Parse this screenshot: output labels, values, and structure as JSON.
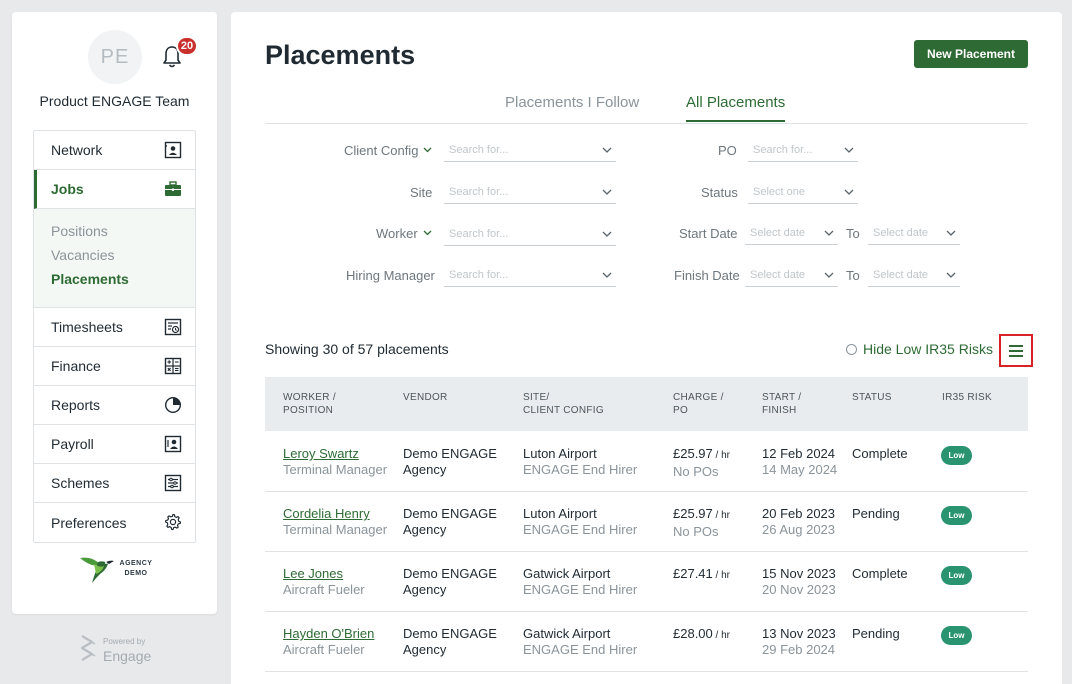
{
  "sidebar": {
    "avatar_initials": "PE",
    "notification_count": "20",
    "team_name": "Product ENGAGE Team",
    "nav": [
      {
        "label": "Network",
        "icon": "contact-card-icon"
      },
      {
        "label": "Jobs",
        "icon": "briefcase-icon"
      },
      {
        "label": "Timesheets",
        "icon": "timesheet-icon"
      },
      {
        "label": "Finance",
        "icon": "calculator-icon"
      },
      {
        "label": "Reports",
        "icon": "pie-chart-icon"
      },
      {
        "label": "Payroll",
        "icon": "payroll-icon"
      },
      {
        "label": "Schemes",
        "icon": "sliders-icon"
      },
      {
        "label": "Preferences",
        "icon": "gear-icon"
      }
    ],
    "jobs_sub": [
      "Positions",
      "Vacancies",
      "Placements"
    ],
    "agency_logo_text": "AGENCY DEMO",
    "powered_by": "Powered by",
    "powered_brand": "Engage"
  },
  "main": {
    "title": "Placements",
    "new_button": "New Placement",
    "tabs": [
      "Placements I Follow",
      "All Placements"
    ],
    "filters": {
      "client_config": {
        "label": "Client Config",
        "placeholder": "Search for..."
      },
      "site": {
        "label": "Site",
        "placeholder": "Search for..."
      },
      "worker": {
        "label": "Worker",
        "placeholder": "Search for..."
      },
      "hiring_manager": {
        "label": "Hiring Manager",
        "placeholder": "Search for..."
      },
      "po": {
        "label": "PO",
        "placeholder": "Search for..."
      },
      "status": {
        "label": "Status",
        "placeholder": "Select one"
      },
      "start_date": {
        "label": "Start Date",
        "placeholder": "Select date"
      },
      "finish_date": {
        "label": "Finish Date",
        "placeholder": "Select date"
      },
      "to_label": "To"
    },
    "showing": "Showing 30 of 57 placements",
    "hide_low_ir35": "Hide Low IR35 Risks",
    "columns": {
      "worker": [
        "WORKER /",
        "POSITION"
      ],
      "vendor": [
        "VENDOR"
      ],
      "site": [
        "SITE/",
        "CLIENT CONFIG"
      ],
      "charge": [
        "CHARGE /",
        "PO"
      ],
      "start": [
        "START /",
        "FINISH"
      ],
      "status": [
        "STATUS"
      ],
      "ir35": [
        "IR35 RISK"
      ]
    },
    "rows": [
      {
        "worker": "Leroy Swartz",
        "position": "Terminal Manager",
        "vendor1": "Demo ENGAGE",
        "vendor2": "Agency",
        "site": "Luton Airport",
        "client_config": "ENGAGE End Hirer",
        "charge": "£25.97",
        "unit": " / hr",
        "po": "No POs",
        "start": "12 Feb 2024",
        "finish": "14 May 2024",
        "status": "Complete",
        "ir35": "Low"
      },
      {
        "worker": "Cordelia Henry",
        "position": "Terminal Manager",
        "vendor1": "Demo ENGAGE",
        "vendor2": "Agency",
        "site": "Luton Airport",
        "client_config": "ENGAGE End Hirer",
        "charge": "£25.97",
        "unit": " / hr",
        "po": "No POs",
        "start": "20 Feb 2023",
        "finish": "26 Aug 2023",
        "status": "Pending",
        "ir35": "Low"
      },
      {
        "worker": "Lee Jones",
        "position": "Aircraft Fueler",
        "vendor1": "Demo ENGAGE",
        "vendor2": "Agency",
        "site": "Gatwick Airport",
        "client_config": "ENGAGE End Hirer",
        "charge": "£27.41",
        "unit": " / hr",
        "po": "",
        "start": "15 Nov 2023",
        "finish": "20 Nov 2023",
        "status": "Complete",
        "ir35": "Low"
      },
      {
        "worker": "Hayden O'Brien",
        "position": "Aircraft Fueler",
        "vendor1": "Demo ENGAGE",
        "vendor2": "Agency",
        "site": "Gatwick Airport",
        "client_config": "ENGAGE End Hirer",
        "charge": "£28.00",
        "unit": " / hr",
        "po": "",
        "start": "13 Nov 2023",
        "finish": "29 Feb 2024",
        "status": "Pending",
        "ir35": "Low"
      }
    ]
  },
  "colors": {
    "brand_green": "#2e6b34",
    "badge_red": "#c9302c",
    "low_risk": "#2a9470",
    "highlight": "#d92128"
  }
}
